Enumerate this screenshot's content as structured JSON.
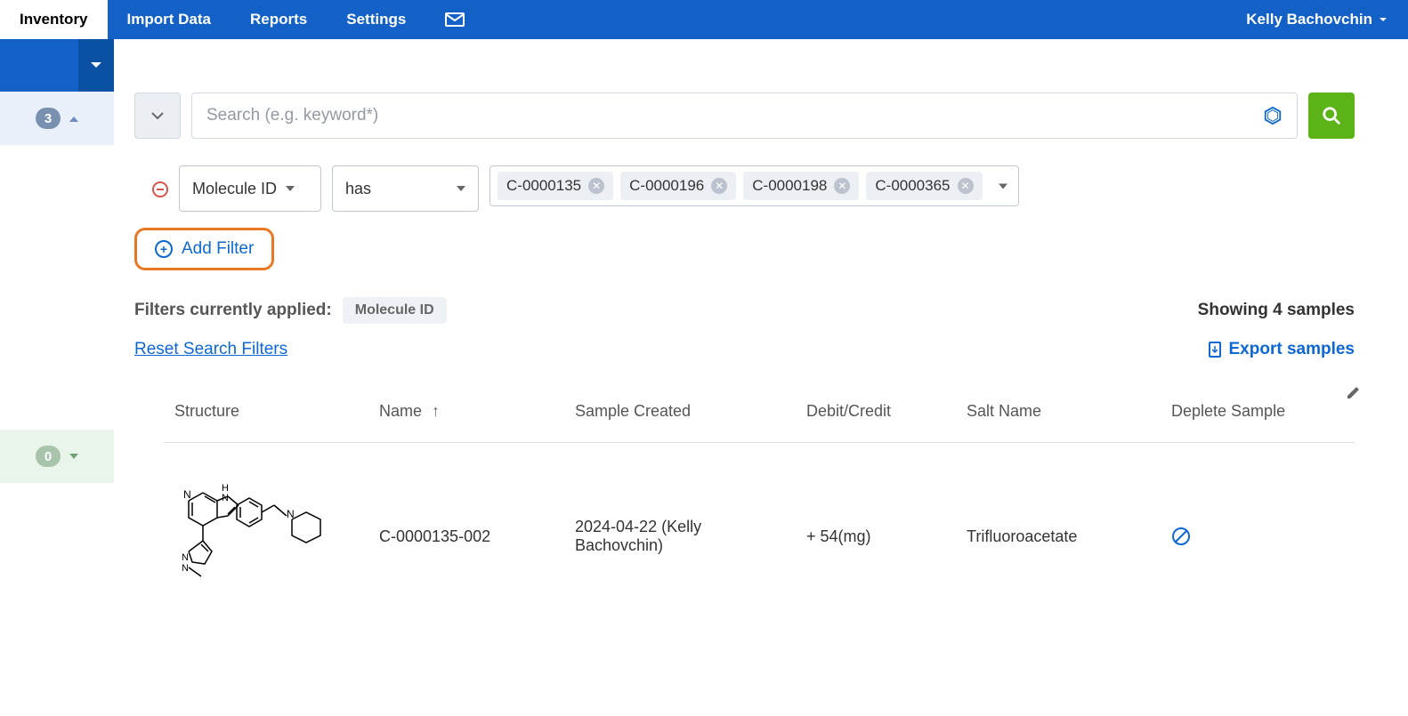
{
  "nav": {
    "tabs": [
      "Inventory",
      "Import Data",
      "Reports",
      "Settings"
    ],
    "active_index": 0,
    "user": "Kelly Bachovchin"
  },
  "sidebar": {
    "blue_count": "3",
    "green_count": "0"
  },
  "search": {
    "placeholder": "Search (e.g. keyword*)",
    "value": ""
  },
  "filter": {
    "field": "Molecule ID",
    "operator": "has",
    "chips": [
      "C-0000135",
      "C-0000196",
      "C-0000198",
      "C-0000365"
    ],
    "add_label": "Add Filter"
  },
  "applied": {
    "label": "Filters currently applied:",
    "chip": "Molecule ID",
    "showing": "Showing 4 samples"
  },
  "links": {
    "reset": "Reset Search Filters",
    "export": "Export samples"
  },
  "table": {
    "headers": {
      "structure": "Structure",
      "name": "Name",
      "created": "Sample Created",
      "debit": "Debit/Credit",
      "salt": "Salt Name",
      "deplete": "Deplete Sample"
    },
    "rows": [
      {
        "name": "C-0000135-002",
        "created": "2024-04-22 (Kelly Bachovchin)",
        "debit": "+ 54(mg)",
        "salt": "Trifluoroacetate"
      }
    ]
  }
}
